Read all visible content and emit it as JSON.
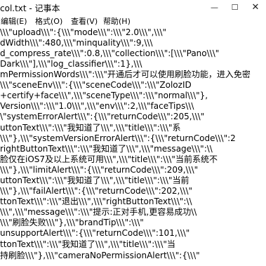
{
  "window": {
    "title": "col.txt - 记事本",
    "minimize_glyph": "—",
    "maximize_glyph": "☐",
    "close_glyph": "✕"
  },
  "menu": {
    "items": [
      {
        "label": "编辑(E)"
      },
      {
        "label": "格式(O)"
      },
      {
        "label": "查看(V)"
      },
      {
        "label": "帮助(H)"
      }
    ]
  },
  "editor": {
    "lines": [
      "\\\\\\\"upload\\\\\\\":{\\\\\\\"mode\\\\\\\":\\\\\\\"2.0\\\\\\\",\\\\\\\"",
      "dWidth\\\\\\\":480,\\\\\\\"minquality\\\\\\\":9,\\\\\\",
      "d_compress_rate\\\\\\\":0.8,\\\\\\\"collection\\\\\\\":[\\\\\\\"Pano\\\\\\\"",
      "Dark\\\\\\\"],\\\\\\\"log_classifier\\\\\\\":1},\\\\\\",
      "mPermissionWords\\\\\\\":\\\\\\\"开通后才可以使用刷脸功能，进入免密",
      "\\\\\\\"sceneEnv\\\\\\\":{\\\\\\\"sceneCode\\\\\\\":\\\\\\\"ZolozID",
      "+certify+face\\\\\\\",\\\\\\\"sceneType\\\\\\\":\\\\\\\"normal\\\\\\\"},",
      "Version\\\\\\\":\\\\\\\"1.0\\\\\\\",\\\\\\\"env\\\\\\\":2,\\\\\\\"faceTips\\\\\\",
      "\\\"systemErrorAlert\\\\\\\":{\\\\\\\"returnCode\\\\\\\":205,\\\\\\\"",
      "uttonText\\\\\\\":\\\\\\\"我知道了\\\\\\\",\\\\\\\"title\\\\\\\":\\\\\\\"系",
      "\\\\\\\"},\\\\\\\"systemVersionErrorAlert\\\\\\\":{\\\\\\\"returnCode\\\\\\\":2",
      "rightButtonText\\\\\\\":\\\\\\\"我知道了\\\\\\\",\\\\\\\"message\\\\\\\":\\\\",
      "脸仅在iOS7及以上系统可用\\\\\\\",\\\\\\\"title\\\\\\\":\\\\\\\"当前系统不",
      "\\\\\\\"},\\\\\\\"limitAlert\\\\\\\":{\\\\\\\"returnCode\\\\\\\":209,\\\\\\\"",
      "uttonText\\\\\\\":\\\\\\\"我知道了\\\\\\\",\\\\\\\"title\\\\\\\":\\\\\\\"当前",
      "\\\\\\\"},\\\\\\\"failAlert\\\\\\\":{\\\\\\\"returnCode\\\\\\\":202,\\\\\\\"",
      "ttonText\\\\\\\":\\\\\\\"退出\\\\\\\",\\\\\\\"rightButtonText\\\\\\\":\\\\",
      "\\\\\\\",\\\\\\\"message\\\\\\\":\\\\\\\"提示:正对手机,更容易成功\\\\",
      "\\\\\\\"刷脸失败\\\\\\\"},\\\\\\\"brandTip\\\\\\\":\\\\\\\"",
      "unsupportAlert\\\\\\\":{\\\\\\\"returnCode\\\\\\\":101,\\\\\\\"",
      "ttonText\\\\\\\":\\\\\\\"我知道了\\\\\\\",\\\\\\\"title\\\\\\\":\\\\\\\"当",
      "持刷脸\\\\\\\"},\\\\\\\"cameraNoPermissionAlert\\\\\\\":{\\\\\\\""
    ]
  }
}
